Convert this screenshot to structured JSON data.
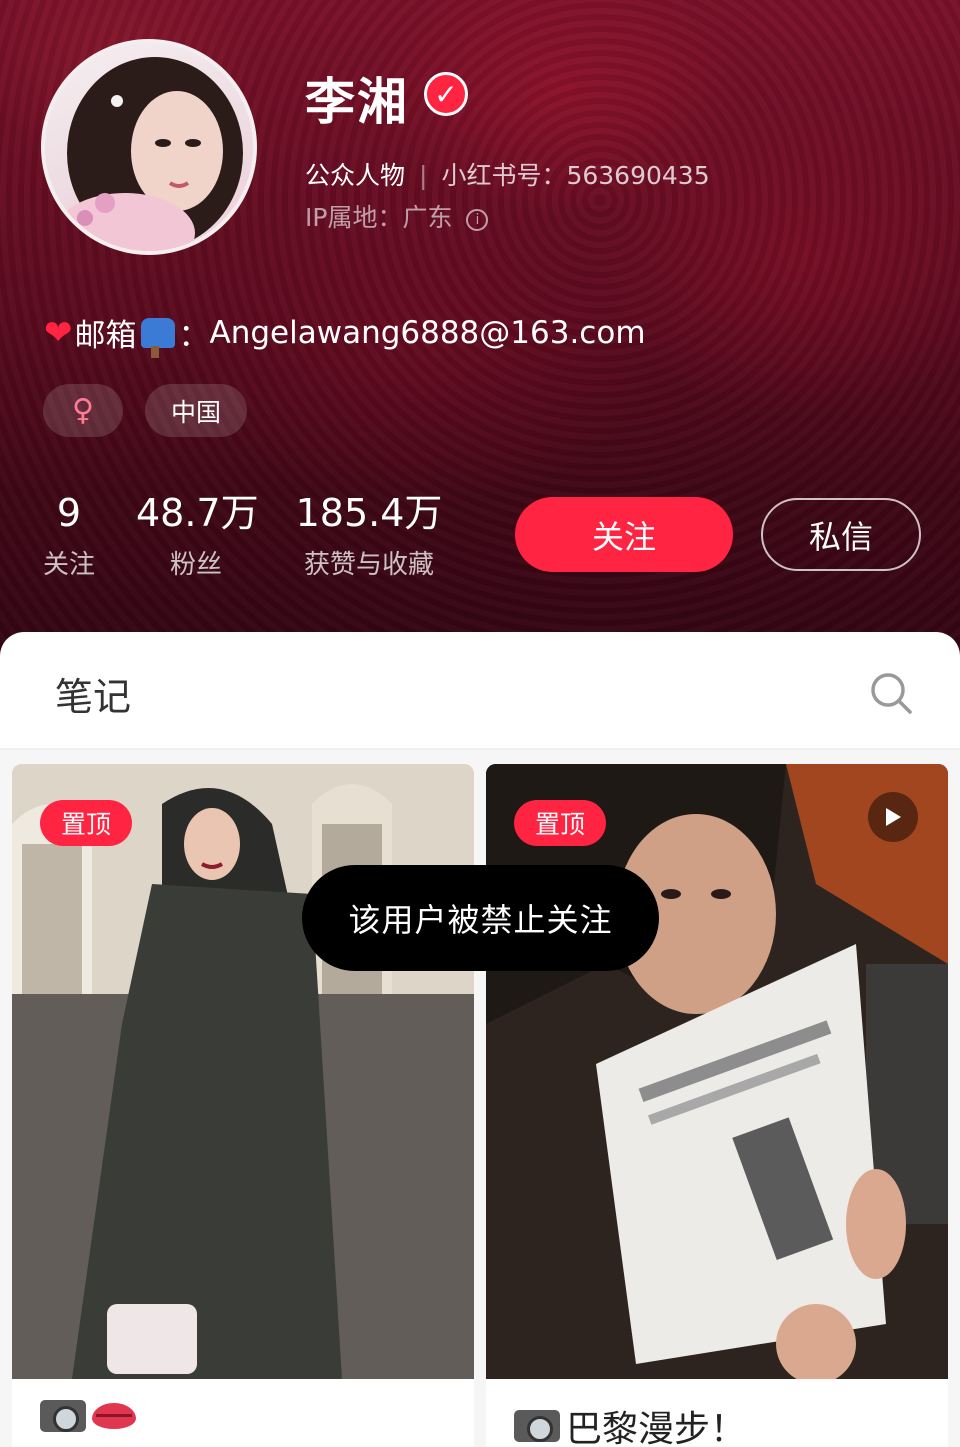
{
  "profile": {
    "name": "李湘",
    "verified": true,
    "role": "公众人物",
    "id_label": "小红书号：563690435",
    "ip_label": "IP属地：广东",
    "bio_text": "邮箱",
    "bio_email": "Angelawang6888@163.com",
    "tags": {
      "gender": "♀",
      "region": "中国"
    }
  },
  "stats": [
    {
      "value": "9",
      "label": "关注"
    },
    {
      "value": "48.7万",
      "label": "粉丝"
    },
    {
      "value": "185.4万",
      "label": "获赞与收藏"
    }
  ],
  "actions": {
    "follow": "关注",
    "message": "私信"
  },
  "tabs": {
    "notes": "笔记"
  },
  "feed": [
    {
      "badge": "置顶",
      "title": "",
      "has_video": false
    },
    {
      "badge": "置顶",
      "title": "巴黎漫步！",
      "has_video": true
    }
  ],
  "toast": "该用户被禁止关注",
  "colors": {
    "accent": "#ff2442",
    "header_bg": "#5c0b1f"
  }
}
